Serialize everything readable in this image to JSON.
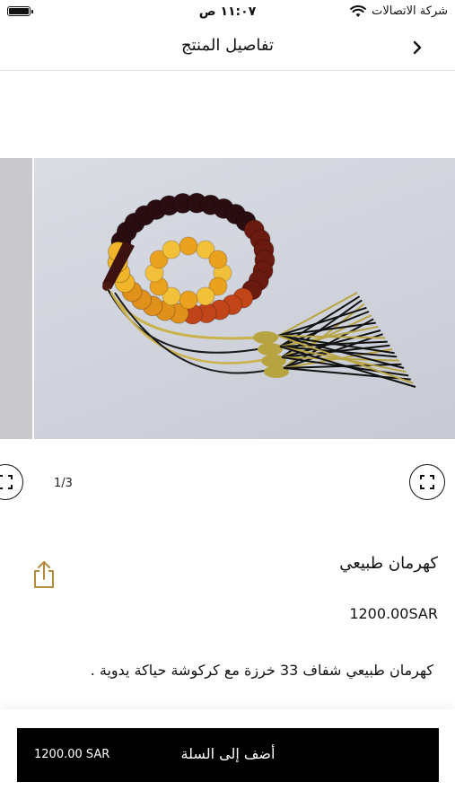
{
  "status_bar": {
    "time": "١١:٠٧ ص",
    "carrier": "شركة الاتصالات"
  },
  "header": {
    "title": "تفاصيل المنتج",
    "back_icon": "chevron-right-icon"
  },
  "gallery": {
    "counter": "1/3",
    "fullscreen_icon": "expand-icon"
  },
  "product": {
    "name": "كهرمان طبيعي",
    "price": "1200.00SAR",
    "description": "كهرمان طبيعي شفاف 33 خرزة مع كركوشة حياكة يدوية ."
  },
  "cart": {
    "label": "أضف إلى السلة",
    "price": "1200.00 SAR"
  },
  "colors": {
    "accent": "#b38a3f",
    "button_bg": "#000000"
  }
}
